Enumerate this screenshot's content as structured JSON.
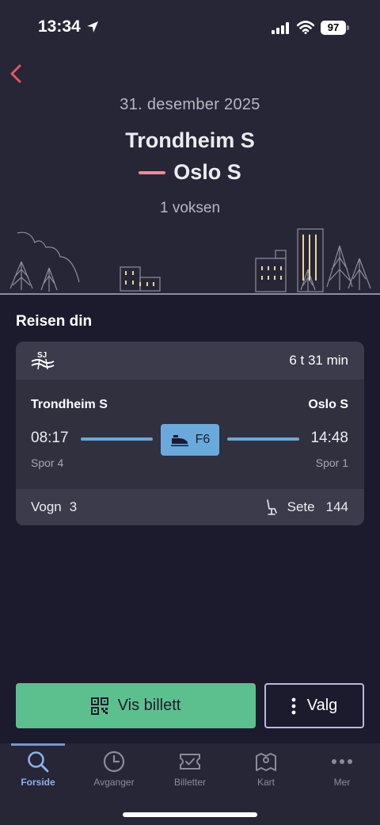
{
  "status_bar": {
    "time": "13:34",
    "battery": "97"
  },
  "header": {
    "date": "31. desember 2025",
    "from": "Trondheim S",
    "to": "Oslo S",
    "passengers": "1 voksen"
  },
  "section_title": "Reisen din",
  "trip": {
    "operator_logo": "SJ",
    "duration": "6 t 31 min",
    "from_station": "Trondheim S",
    "to_station": "Oslo S",
    "departure": "08:17",
    "arrival": "14:48",
    "train_id": "F6",
    "from_track": "Spor 4",
    "to_track": "Spor 1",
    "car_label": "Vogn",
    "car_number": "3",
    "seat_label": "Sete",
    "seat_number": "144"
  },
  "actions": {
    "show_ticket": "Vis billett",
    "options": "Valg"
  },
  "tabs": [
    {
      "label": "Forside",
      "icon": "search-icon",
      "active": true
    },
    {
      "label": "Avganger",
      "icon": "clock-icon",
      "active": false
    },
    {
      "label": "Billetter",
      "icon": "ticket-icon",
      "active": false
    },
    {
      "label": "Kart",
      "icon": "map-icon",
      "active": false
    },
    {
      "label": "Mer",
      "icon": "more-icon",
      "active": false
    }
  ],
  "colors": {
    "background": "#1b1b2d",
    "header": "#262637",
    "accent_green": "#5cc08e",
    "accent_blue": "#6aa9dc",
    "route_dash": "#f08b8f",
    "back_arrow": "#e8565f"
  }
}
